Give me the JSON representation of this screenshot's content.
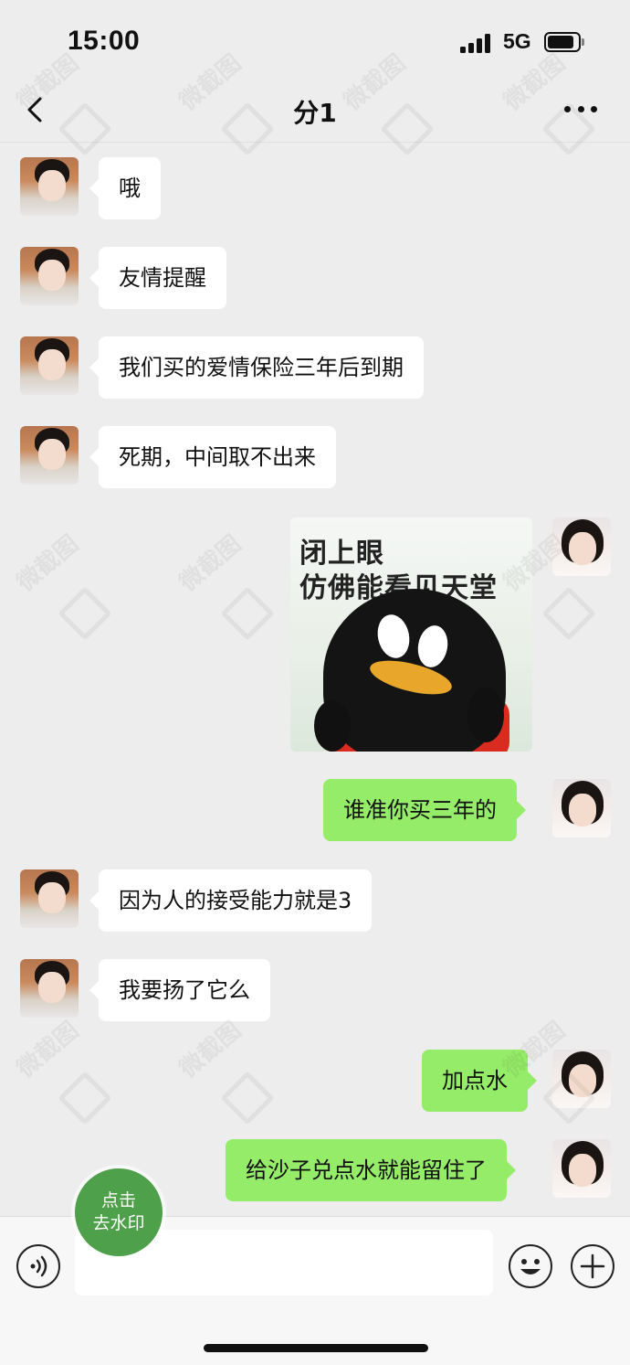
{
  "status_bar": {
    "time": "15:00",
    "network": "5G",
    "signal_bars": 4,
    "battery_level": 0.75
  },
  "nav": {
    "title": "分1",
    "back_icon": "chevron-left-icon",
    "more_icon": "more-dots-icon"
  },
  "messages": [
    {
      "side": "in",
      "text": "哦"
    },
    {
      "side": "in",
      "text": "友情提醒"
    },
    {
      "side": "in",
      "text": "我们买的爱情保险三年后到期"
    },
    {
      "side": "in",
      "text": "死期，中间取不出来"
    },
    {
      "side": "out",
      "type": "sticker",
      "caption_line1": "闭上眼",
      "caption_line2": "仿佛能看见天堂"
    },
    {
      "side": "out",
      "text": "谁准你买三年的"
    },
    {
      "side": "in",
      "text": "因为人的接受能力就是3"
    },
    {
      "side": "in",
      "text": "我要扬了它么"
    },
    {
      "side": "out",
      "text": "加点水"
    },
    {
      "side": "out",
      "text": "给沙子兑点水就能留住了"
    }
  ],
  "watermark": {
    "text": "微截图"
  },
  "floating_button": {
    "line1": "点击",
    "line2": "去水印"
  },
  "input_bar": {
    "voice_icon": "voice-icon",
    "emoji_icon": "emoji-icon",
    "plus_icon": "plus-icon",
    "input_value": "",
    "input_placeholder": ""
  },
  "colors": {
    "background": "#ededed",
    "incoming_bubble": "#ffffff",
    "outgoing_bubble": "#95ec69",
    "floating_button": "#4ea04a"
  }
}
